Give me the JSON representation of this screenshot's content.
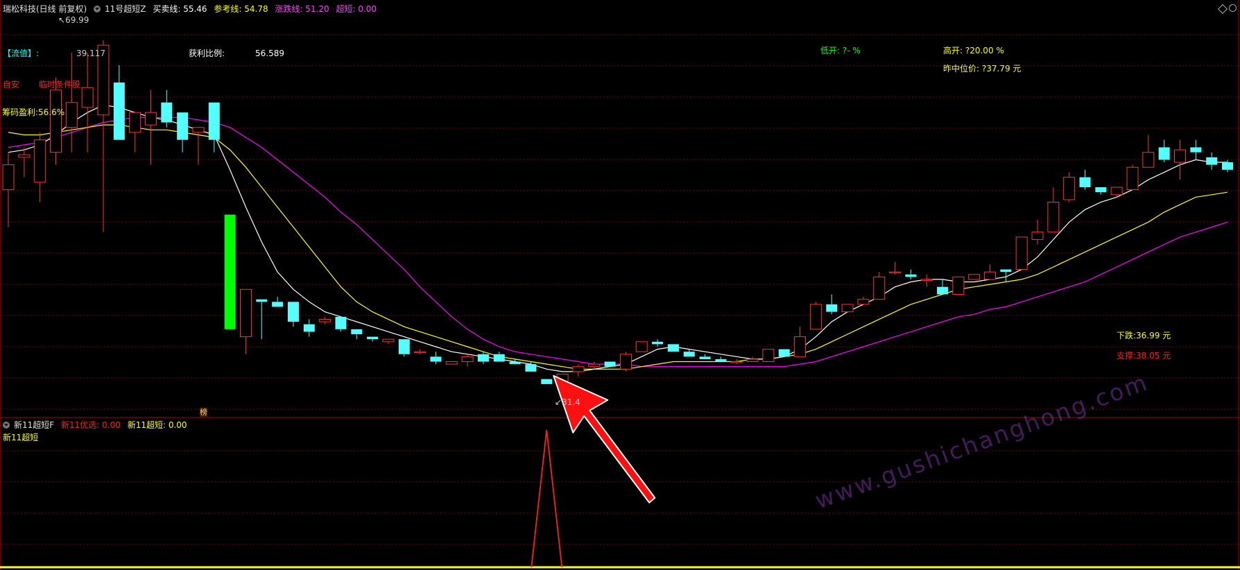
{
  "header": {
    "title": "瑞松科技(日线 前复权)",
    "indicator": "11号超短Z",
    "items": [
      {
        "label": "买卖线: 55.46",
        "color": "#ffffff"
      },
      {
        "label": "参考线: 54.78",
        "color": "#ffff00"
      },
      {
        "label": "涨跌线: 51.20",
        "color": "#ff40ff"
      },
      {
        "label": "超短: 0.00",
        "color": "#ff40ff"
      }
    ]
  },
  "upper_labels": {
    "high_price": "69.99",
    "low_price": "31.4",
    "liuzhi": "【流值】:",
    "liuzhi_val": "39.117",
    "zijin": "自安",
    "temp": "临时条件股",
    "chouma": "筹码盈利:56.6%",
    "profit_ratio": "获利比例:",
    "profit_ratio_val": "56.589",
    "low_open": "低开: ?- %",
    "high_open": "高开: ?20.00 %",
    "mid_price": "昨中位价: ?37.79 元",
    "down": "下跌:36.99 元",
    "support": "支撑:38.05 元",
    "marker": "榜"
  },
  "lower_panel": {
    "indicator": "新11超短F",
    "item1": "新11优选: 0.00",
    "item2": "新11超短: 0.00",
    "name": "新11超短"
  },
  "watermark": "www.gushichanghong.com",
  "colors": {
    "up": "#ff3232",
    "down": "#54ffff",
    "bigdown": "#00ff00",
    "ma_white": "#ffffff",
    "ma_yellow": "#ffff00",
    "ma_magenta": "#ff00ff",
    "grid": "#7a0000",
    "arrow": "#ff1010"
  },
  "chart_data": {
    "type": "candlestick",
    "title": "瑞松科技(日线 前复权)",
    "ohlc": [
      [
        39.5,
        41.0,
        38.0,
        40.5
      ],
      [
        40.8,
        41.2,
        40.0,
        40.9
      ],
      [
        39.8,
        41.8,
        39.0,
        41.5
      ],
      [
        41.0,
        44.0,
        40.5,
        43.5
      ],
      [
        42.0,
        45.0,
        41.0,
        43.0
      ],
      [
        42.8,
        45.0,
        41.0,
        43.6
      ],
      [
        42.5,
        45.5,
        37.8,
        45.3
      ],
      [
        43.8,
        44.5,
        41.5,
        41.5
      ],
      [
        41.8,
        42.6,
        41.0,
        42.6
      ],
      [
        42.1,
        43.5,
        40.5,
        42.6
      ],
      [
        43.0,
        43.5,
        42.0,
        42.2
      ],
      [
        42.6,
        42.6,
        41.0,
        41.5
      ],
      [
        41.8,
        42.0,
        40.5,
        42.0
      ],
      [
        43.0,
        43.0,
        41.0,
        41.5
      ],
      [
        38.5,
        38.5,
        33.9,
        33.9
      ],
      [
        33.6,
        35.5,
        32.9,
        35.5
      ],
      [
        35.1,
        35.1,
        33.5,
        35.0
      ],
      [
        35.0,
        35.2,
        34.8,
        34.8
      ],
      [
        35.0,
        35.0,
        34.0,
        34.2
      ],
      [
        34.1,
        34.3,
        33.6,
        33.8
      ],
      [
        34.2,
        34.4,
        34.1,
        34.3
      ],
      [
        34.4,
        34.4,
        33.8,
        33.9
      ],
      [
        33.9,
        33.9,
        33.5,
        33.7
      ],
      [
        33.6,
        33.6,
        33.4,
        33.5
      ],
      [
        33.4,
        33.5,
        33.3,
        33.5
      ],
      [
        33.5,
        33.5,
        32.8,
        32.9
      ],
      [
        33.0,
        33.1,
        32.9,
        33.0
      ],
      [
        32.8,
        33.0,
        32.5,
        32.6
      ],
      [
        32.5,
        32.6,
        32.6,
        32.6
      ],
      [
        32.6,
        32.9,
        32.4,
        32.8
      ],
      [
        32.9,
        33.0,
        32.5,
        32.6
      ],
      [
        32.9,
        33.0,
        32.6,
        32.6
      ],
      [
        32.6,
        32.7,
        32.5,
        32.5
      ],
      [
        32.5,
        32.6,
        32.2,
        32.2
      ],
      [
        31.9,
        31.9,
        31.7,
        31.7
      ],
      [
        31.8,
        32.1,
        31.6,
        32.1
      ],
      [
        32.2,
        32.5,
        32.0,
        32.4
      ],
      [
        32.4,
        32.6,
        32.3,
        32.5
      ],
      [
        32.6,
        32.6,
        32.4,
        32.4
      ],
      [
        32.3,
        33.0,
        32.2,
        32.9
      ],
      [
        33.0,
        33.4,
        33.0,
        33.4
      ],
      [
        33.4,
        33.5,
        33.2,
        33.3
      ],
      [
        33.3,
        33.3,
        33.0,
        33.0
      ],
      [
        33.0,
        33.1,
        32.8,
        32.8
      ],
      [
        32.8,
        32.9,
        32.7,
        32.7
      ],
      [
        32.7,
        32.8,
        32.6,
        32.6
      ],
      [
        32.6,
        32.7,
        32.5,
        32.6
      ],
      [
        32.6,
        32.8,
        32.6,
        32.7
      ],
      [
        32.6,
        33.1,
        32.6,
        33.1
      ],
      [
        33.1,
        33.1,
        32.8,
        32.8
      ],
      [
        32.8,
        34.0,
        32.8,
        33.6
      ],
      [
        33.9,
        35.0,
        33.9,
        34.9
      ],
      [
        34.9,
        35.3,
        34.5,
        34.6
      ],
      [
        34.6,
        34.9,
        34.6,
        34.9
      ],
      [
        34.9,
        35.2,
        34.9,
        35.1
      ],
      [
        35.1,
        36.2,
        35.1,
        36.0
      ],
      [
        36.2,
        36.6,
        36.1,
        36.2
      ],
      [
        36.1,
        36.3,
        35.9,
        36.0
      ],
      [
        35.9,
        36.1,
        35.6,
        35.9
      ],
      [
        35.6,
        35.9,
        35.3,
        35.3
      ],
      [
        35.3,
        36.0,
        35.3,
        36.0
      ],
      [
        35.9,
        36.1,
        35.9,
        36.1
      ],
      [
        35.9,
        36.5,
        35.9,
        36.2
      ],
      [
        36.3,
        36.3,
        35.8,
        36.2
      ],
      [
        36.3,
        37.6,
        36.3,
        37.6
      ],
      [
        37.5,
        38.3,
        37.3,
        37.8
      ],
      [
        37.8,
        39.6,
        37.8,
        39.0
      ],
      [
        39.1,
        40.2,
        39.0,
        40.0
      ],
      [
        40.0,
        40.3,
        39.5,
        39.6
      ],
      [
        39.6,
        39.6,
        39.3,
        39.4
      ],
      [
        39.3,
        39.6,
        39.2,
        39.6
      ],
      [
        39.5,
        40.5,
        39.5,
        40.4
      ],
      [
        40.4,
        41.7,
        40.4,
        41.0
      ],
      [
        41.2,
        41.5,
        40.6,
        40.7
      ],
      [
        40.6,
        41.5,
        39.9,
        41.1
      ],
      [
        41.2,
        41.5,
        40.7,
        41.0
      ],
      [
        40.8,
        41.0,
        40.3,
        40.5
      ],
      [
        40.6,
        40.7,
        40.2,
        40.3
      ]
    ],
    "ma_fast": [
      41.0,
      41.1,
      41.3,
      41.7,
      42.2,
      42.6,
      42.9,
      42.8,
      42.6,
      42.4,
      42.3,
      42.1,
      41.9,
      41.7,
      40.3,
      38.8,
      37.4,
      36.2,
      35.5,
      35.0,
      34.6,
      34.4,
      34.2,
      34.0,
      33.8,
      33.6,
      33.4,
      33.2,
      33.0,
      32.9,
      32.8,
      32.7,
      32.6,
      32.5,
      32.3,
      32.2,
      32.2,
      32.3,
      32.4,
      32.5,
      32.8,
      33.1,
      33.2,
      33.1,
      33.0,
      32.9,
      32.8,
      32.7,
      32.7,
      32.8,
      33.1,
      33.6,
      34.2,
      34.6,
      34.9,
      35.2,
      35.6,
      35.8,
      35.9,
      35.9,
      35.8,
      35.8,
      35.9,
      36.0,
      36.3,
      36.8,
      37.5,
      38.2,
      38.7,
      39.0,
      39.2,
      39.5,
      39.9,
      40.2,
      40.5,
      40.7,
      40.6,
      40.6
    ],
    "ma_mid": [
      41.8,
      41.7,
      41.7,
      41.8,
      41.9,
      42.0,
      42.1,
      42.1,
      42.0,
      41.9,
      41.9,
      41.8,
      41.7,
      41.6,
      41.1,
      40.4,
      39.6,
      38.8,
      38.0,
      37.2,
      36.4,
      35.6,
      35.0,
      34.6,
      34.3,
      34.0,
      33.8,
      33.6,
      33.4,
      33.2,
      33.0,
      32.8,
      32.7,
      32.6,
      32.5,
      32.4,
      32.3,
      32.3,
      32.3,
      32.3,
      32.4,
      32.5,
      32.6,
      32.6,
      32.6,
      32.6,
      32.6,
      32.7,
      32.7,
      32.8,
      32.9,
      33.1,
      33.4,
      33.7,
      34.0,
      34.3,
      34.6,
      34.9,
      35.1,
      35.3,
      35.5,
      35.6,
      35.7,
      35.8,
      35.9,
      36.1,
      36.4,
      36.7,
      37.0,
      37.3,
      37.6,
      37.9,
      38.2,
      38.6,
      38.9,
      39.2,
      39.3,
      39.4
    ],
    "ma_slow": [
      41.2,
      41.3,
      41.4,
      41.6,
      41.8,
      42.0,
      42.2,
      42.3,
      42.4,
      42.4,
      42.4,
      42.4,
      42.3,
      42.2,
      42.0,
      41.6,
      41.2,
      40.7,
      40.2,
      39.7,
      39.2,
      38.6,
      38.1,
      37.5,
      36.9,
      36.3,
      35.6,
      35.0,
      34.4,
      33.9,
      33.5,
      33.2,
      33.0,
      32.9,
      32.8,
      32.7,
      32.6,
      32.5,
      32.5,
      32.5,
      32.4,
      32.4,
      32.4,
      32.4,
      32.4,
      32.4,
      32.4,
      32.4,
      32.4,
      32.4,
      32.5,
      32.6,
      32.8,
      33.0,
      33.2,
      33.4,
      33.6,
      33.8,
      34.0,
      34.2,
      34.4,
      34.5,
      34.7,
      34.8,
      35.0,
      35.2,
      35.4,
      35.6,
      35.8,
      36.1,
      36.4,
      36.7,
      37.0,
      37.3,
      37.6,
      37.8,
      38.0,
      38.2
    ],
    "signal": [
      0,
      0,
      0,
      0,
      0,
      0,
      0,
      0,
      0,
      0,
      0,
      0,
      0,
      0,
      0,
      0,
      0,
      0,
      0,
      0,
      0,
      0,
      0,
      0,
      0,
      0,
      0,
      0,
      0,
      0,
      0,
      0,
      0,
      0,
      1,
      0,
      0,
      0,
      0,
      0,
      0,
      0,
      0,
      0,
      0,
      0,
      0,
      0,
      0,
      0,
      0,
      0,
      0,
      0,
      0,
      0,
      0,
      0,
      0,
      0,
      0,
      0,
      0,
      0,
      0,
      0,
      0,
      0,
      0,
      0,
      0,
      0,
      0,
      0,
      0,
      0,
      0,
      0
    ],
    "ylim": [
      30.5,
      46.5
    ]
  }
}
